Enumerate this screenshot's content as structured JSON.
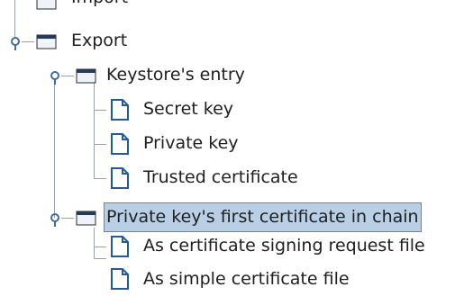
{
  "tree": {
    "nodes": [
      {
        "label": "Import",
        "type": "folder",
        "expanded": false,
        "selected": false
      },
      {
        "label": "Export",
        "type": "folder",
        "expanded": true,
        "selected": false
      },
      {
        "label": "Keystore's entry",
        "type": "folder",
        "expanded": true,
        "selected": false
      },
      {
        "label": "Secret key",
        "type": "file",
        "selected": false
      },
      {
        "label": "Private key",
        "type": "file",
        "selected": false
      },
      {
        "label": "Trusted certificate",
        "type": "file",
        "selected": false
      },
      {
        "label": "Private key's first certificate in chain",
        "type": "folder",
        "expanded": true,
        "selected": true
      },
      {
        "label": "As certificate signing request file",
        "type": "file",
        "selected": false
      },
      {
        "label": "As simple certificate file",
        "type": "file",
        "selected": false
      }
    ]
  },
  "colors": {
    "selection_bg": "#b8cfe5",
    "selection_border": "#6382bf",
    "tree_line": "#9aa0a8",
    "toggle": "#3a6ea5"
  }
}
